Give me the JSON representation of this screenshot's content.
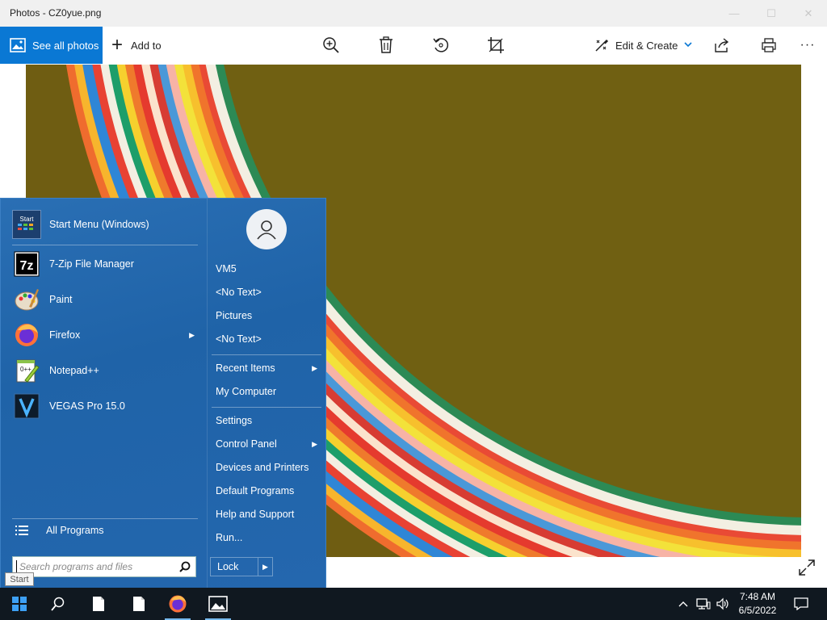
{
  "window": {
    "title": "Photos - CZ0yue.png",
    "controls": {
      "minimize": "—",
      "maximize": "☐",
      "close": "✕"
    }
  },
  "toolbar": {
    "see_all_photos": "See all photos",
    "add_to": "Add to",
    "edit_create": "Edit & Create",
    "icons": [
      "zoom-in-icon",
      "delete-icon",
      "rotate-icon",
      "crop-icon",
      "share-icon",
      "print-icon",
      "more-icon"
    ],
    "more_label": "···"
  },
  "start_menu": {
    "programs": [
      {
        "label": "Start Menu (Windows)",
        "icon": "start-menu-app-icon"
      },
      {
        "label": "7-Zip File Manager",
        "icon": "7zip-icon"
      },
      {
        "label": "Paint",
        "icon": "paint-icon"
      },
      {
        "label": "Firefox",
        "icon": "firefox-icon",
        "submenu": true
      },
      {
        "label": "Notepad++",
        "icon": "notepadpp-icon"
      },
      {
        "label": "VEGAS Pro 15.0",
        "icon": "vegas-icon"
      }
    ],
    "all_programs": "All Programs",
    "search_placeholder": "Search programs and files",
    "start_tile_text": "Start",
    "right_items": [
      {
        "label": "VM5"
      },
      {
        "label": "<No Text>"
      },
      {
        "label": "Pictures"
      },
      {
        "label": "<No Text>"
      },
      {
        "label": "Recent Items",
        "submenu": true
      },
      {
        "label": "My Computer"
      },
      {
        "label": "Settings"
      },
      {
        "label": "Control Panel",
        "submenu": true
      },
      {
        "label": "Devices and Printers"
      },
      {
        "label": "Default Programs"
      },
      {
        "label": "Help and Support"
      },
      {
        "label": "Run..."
      }
    ],
    "lock": "Lock",
    "arrow_glyph": "▶"
  },
  "tooltip": {
    "start": "Start"
  },
  "taskbar": {
    "apps": [
      "windows-start-icon",
      "search-icon",
      "file-icon",
      "file-icon",
      "firefox-icon",
      "photos-icon"
    ],
    "clock_time": "7:48 AM",
    "clock_date": "6/5/2022"
  },
  "colors": {
    "accent": "#0a78d4",
    "start_menu_bg": "#1f63a8",
    "taskbar_bg": "#101820"
  }
}
